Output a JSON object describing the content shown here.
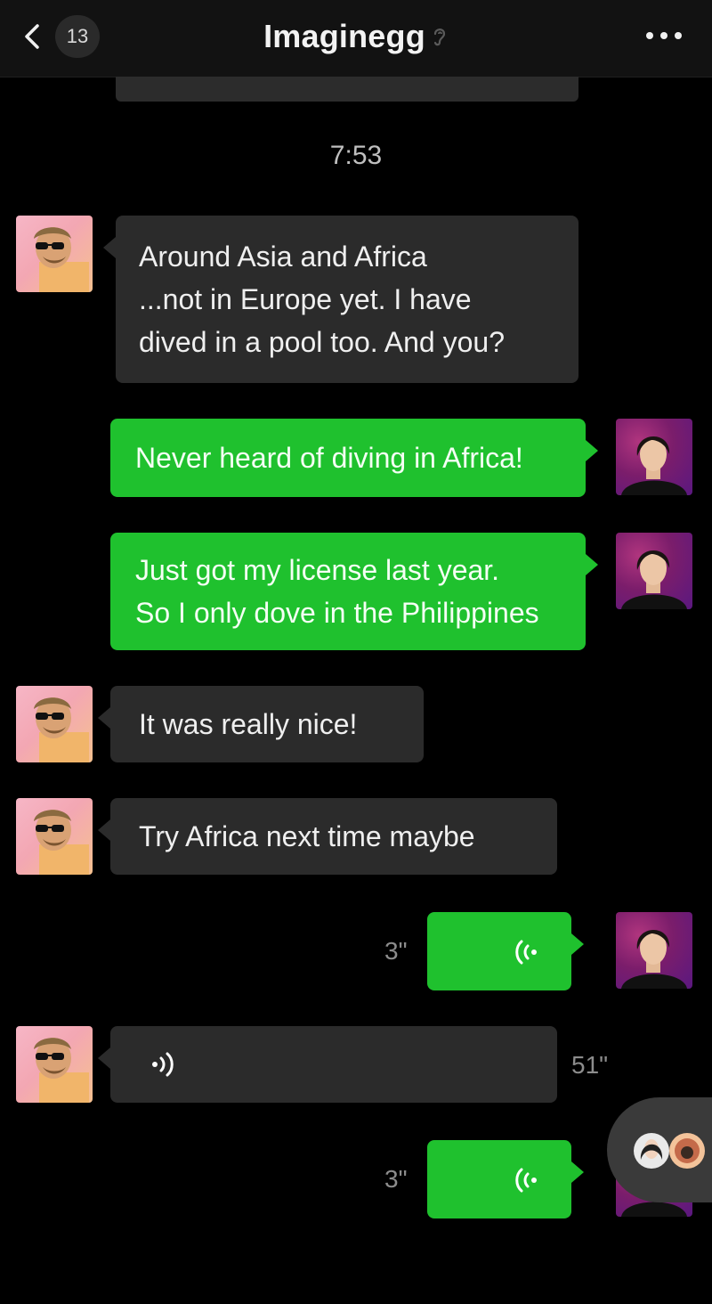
{
  "header": {
    "unread_count": "13",
    "title": "Imaginegg",
    "icons": [
      "back-chevron-icon",
      "ear-icon",
      "more-dots-icon"
    ]
  },
  "chat": {
    "timestamp": "7:53",
    "messages": [
      {
        "side": "in",
        "text": "Around Asia and Africa\n...not in Europe yet. I have\ndived in a pool too. And you?"
      },
      {
        "side": "out",
        "text": "Never heard of diving in Africa!"
      },
      {
        "side": "out",
        "text": "Just got my license last year.\nSo I only dove in the Philippines"
      },
      {
        "side": "in",
        "text": "It was really nice!"
      },
      {
        "side": "in",
        "text": "Try Africa next time maybe"
      },
      {
        "side": "out",
        "type": "voice",
        "duration": "3\""
      },
      {
        "side": "in",
        "type": "voice",
        "duration": "51\""
      },
      {
        "side": "out",
        "type": "voice",
        "duration": "3\""
      }
    ]
  },
  "colors": {
    "outgoing_bubble": "#1fc12e",
    "incoming_bubble": "#2b2b2b",
    "background": "#000000"
  }
}
